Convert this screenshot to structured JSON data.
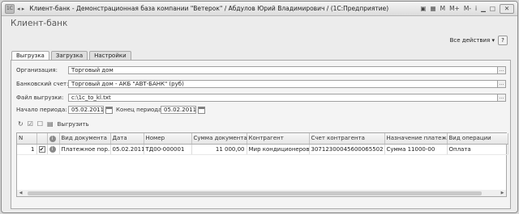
{
  "window": {
    "title": "Клиент-банк - Демонстрационная база компании \"Ветерок\" / Абдулов Юрий Владимирович / (1С:Предприятие)"
  },
  "titlebar_icons": [
    "M",
    "M+",
    "M-",
    "i"
  ],
  "page_title": "Клиент-банк",
  "all_actions": "Все действия ▾",
  "help": "?",
  "tabs": [
    {
      "label": "Выгрузка",
      "active": true
    },
    {
      "label": "Загрузка",
      "active": false
    },
    {
      "label": "Настройки",
      "active": false
    }
  ],
  "form": {
    "org_label": "Организация:",
    "org_value": "Торговый дом",
    "bank_label": "Банковский счет:",
    "bank_value": "Торговый дом - АКБ \"АВТ-БАНК\" (руб)",
    "file_label": "Файл выгрузки:",
    "file_value": "c:\\1c_to_kl.txt",
    "start_label": "Начало периода:",
    "start_value": "05.02.2011",
    "end_label": "Конец периода:",
    "end_value": "05.02.2011"
  },
  "toolbar": {
    "export_label": "Выгрузить"
  },
  "table": {
    "columns": [
      "N",
      "",
      "",
      "Вид документа",
      "Дата",
      "Номер",
      "Сумма документа",
      "Контрагент",
      "Счет контрагента",
      "Назначение платежа",
      "Вид операции"
    ],
    "rows": [
      [
        "1",
        "✔",
        "",
        "Платежное пор...",
        "05.02.2011",
        "ТД00-000001",
        "11 000,00",
        "Мир кондиционеров",
        "30712300045600065502",
        "Сумма 11000-00",
        "Оплата"
      ]
    ]
  }
}
